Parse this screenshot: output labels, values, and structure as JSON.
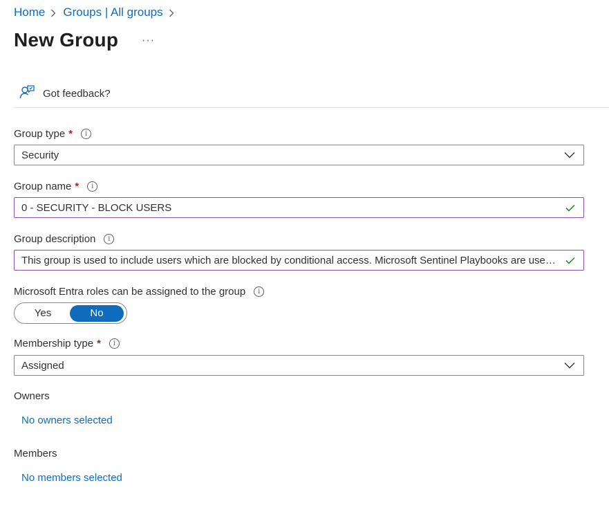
{
  "breadcrumb": {
    "items": [
      "Home",
      "Groups | All groups"
    ]
  },
  "page": {
    "title": "New Group",
    "more_label": "···"
  },
  "feedback": {
    "label": "Got feedback?",
    "icon": "feedback-person-icon"
  },
  "form": {
    "group_type": {
      "label": "Group type",
      "required": "*",
      "info": "i",
      "value": "Security"
    },
    "group_name": {
      "label": "Group name",
      "required": "*",
      "info": "i",
      "value": "0 - SECURITY - BLOCK USERS"
    },
    "group_description": {
      "label": "Group description",
      "info": "i",
      "value": "This group is used to include users which are blocked by conditional access. Microsoft Sentinel Playbooks are used to add users to this group."
    },
    "entra_roles": {
      "label": "Microsoft Entra roles can be assigned to the group",
      "info": "i",
      "options": [
        "Yes",
        "No"
      ],
      "selected": "No"
    },
    "membership_type": {
      "label": "Membership type",
      "required": "*",
      "info": "i",
      "value": "Assigned"
    },
    "owners": {
      "label": "Owners",
      "link": "No owners selected"
    },
    "members": {
      "label": "Members",
      "link": "No members selected"
    }
  },
  "colors": {
    "link": "#0f6cbd",
    "required": "#a4262c",
    "valid_check": "#107c10",
    "valid_border": "#8a50a8",
    "toggle_on": "#0f6cbd"
  }
}
